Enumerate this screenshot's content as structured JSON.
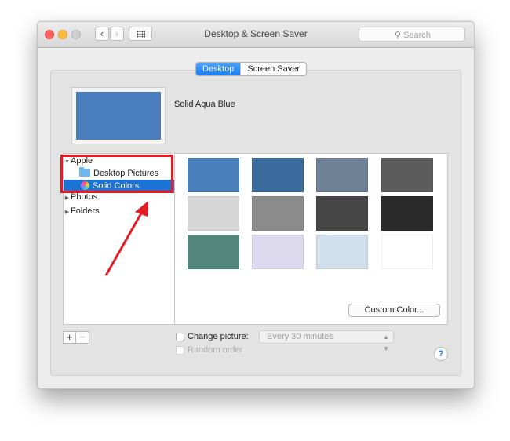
{
  "window": {
    "title": "Desktop & Screen Saver",
    "search_placeholder": "Search",
    "nav": {
      "back": "‹",
      "forward": "›"
    }
  },
  "tabs": [
    {
      "label": "Desktop",
      "active": true
    },
    {
      "label": "Screen Saver",
      "active": false
    }
  ],
  "preview": {
    "color": "#4a7ebc",
    "name": "Solid Aqua Blue"
  },
  "sidebar": {
    "items": [
      {
        "label": "Apple",
        "expanded": true
      },
      {
        "label": "Desktop Pictures"
      },
      {
        "label": "Solid Colors",
        "selected": true
      },
      {
        "label": "Photos",
        "expanded": false
      },
      {
        "label": "Folders",
        "expanded": false
      }
    ]
  },
  "swatches": [
    "#4a7fbc",
    "#3b6a9c",
    "#6f8194",
    "#5c5c5c",
    "#d6d6d6",
    "#8c8c8c",
    "#474747",
    "#2b2b2b",
    "#52867a",
    "#dcd8ee",
    "#d0e0ec",
    "#ffffff"
  ],
  "custom_color_label": "Custom Color...",
  "bottom": {
    "add_label": "+",
    "remove_label": "−",
    "change_picture_label": "Change picture:",
    "interval_value": "Every 30 minutes",
    "random_order_label": "Random order",
    "help_label": "?"
  },
  "colors": {
    "accent": "#1b7ef6",
    "selection": "#1b73d6",
    "annotation": "#e51c24"
  }
}
